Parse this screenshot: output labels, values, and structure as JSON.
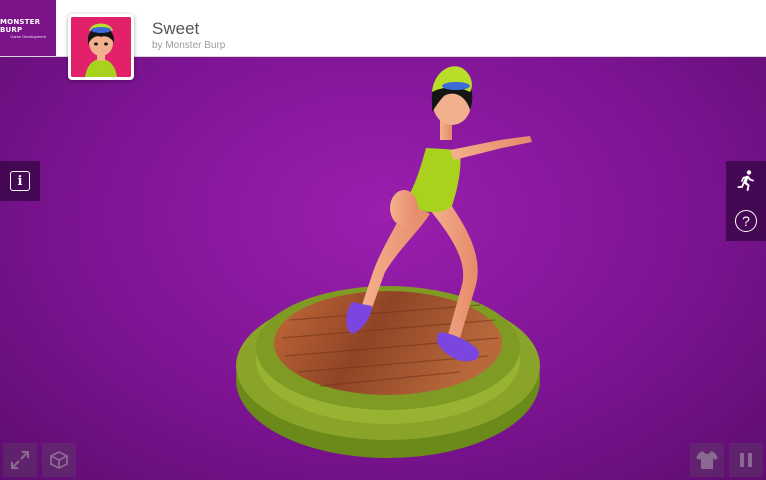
{
  "brand": {
    "name": "MONSTER BURP",
    "tagline": "Game Development"
  },
  "model": {
    "title": "Sweet",
    "author": "by Monster Burp"
  },
  "colors": {
    "background": "#7d1493",
    "accent": "#7a1488",
    "platform_green": "#8aa42a",
    "wood": "#a4552f"
  },
  "icons": {
    "info": "info-icon",
    "animation": "running-figure-icon",
    "help": "question-mark-icon",
    "fullscreen": "expand-arrows-icon",
    "view": "3d-box-icon",
    "customize": "tshirt-icon",
    "pause": "pause-icon"
  },
  "labels": {
    "info": "i",
    "help": "?"
  }
}
